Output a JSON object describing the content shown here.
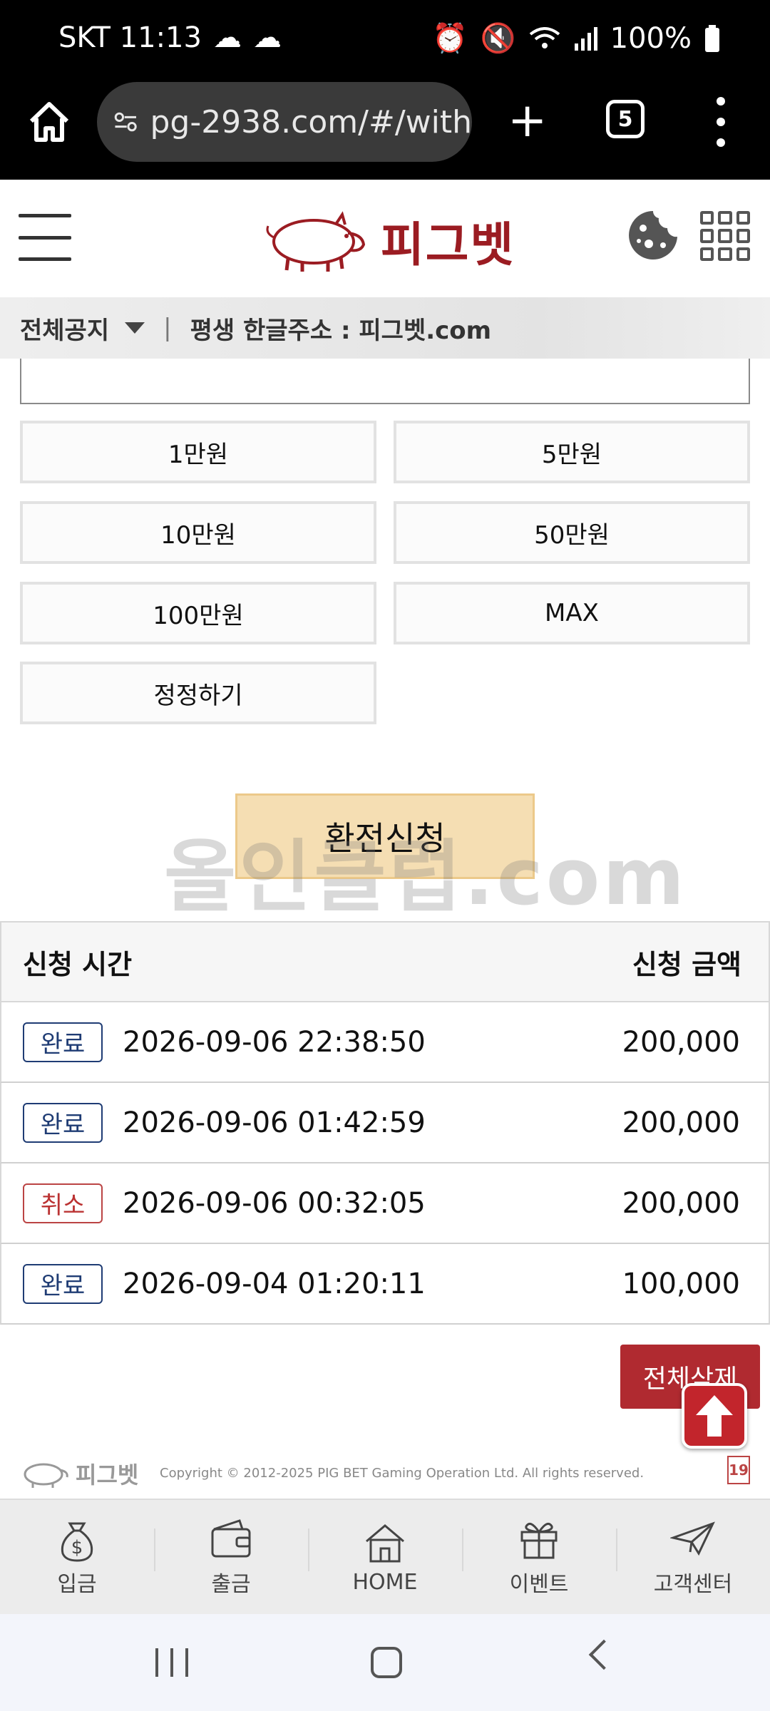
{
  "status_bar": {
    "carrier_time": "SKT 11:13",
    "battery": "100%"
  },
  "browser": {
    "url": "pg-2938.com/#/with",
    "tab_count": "5"
  },
  "header": {
    "logo_text": "피그벳"
  },
  "notice": {
    "category": "전체공지",
    "separator": "|",
    "message": "평생 한글주소 : 피그벳.com"
  },
  "amount_buttons": {
    "b1": "1만원",
    "b2": "5만원",
    "b3": "10만원",
    "b4": "50만원",
    "b5": "100만원",
    "b6": "MAX",
    "reset": "정정하기"
  },
  "submit_label": "환전신청",
  "history": {
    "col_time": "신청 시간",
    "col_amount": "신청 금액",
    "rows": [
      {
        "status": "완료",
        "time": "2026-09-06 22:38:50",
        "amount": "200,000"
      },
      {
        "status": "완료",
        "time": "2026-09-06 01:42:59",
        "amount": "200,000"
      },
      {
        "status": "취소",
        "time": "2026-09-06 00:32:05",
        "amount": "200,000"
      },
      {
        "status": "완료",
        "time": "2026-09-04 01:20:11",
        "amount": "100,000"
      }
    ]
  },
  "delete_all_label": "전체삭제",
  "footer": {
    "logo_text": "피그벳",
    "copyright": "Copyright © 2012-2025 PIG BET Gaming Operation Ltd. All rights reserved.",
    "age_mark": "19"
  },
  "bottom_nav": {
    "deposit": "입금",
    "withdraw": "출금",
    "home": "HOME",
    "event": "이벤트",
    "support": "고객센터"
  },
  "colors": {
    "brand_red": "#b02a30",
    "submit_bg": "#f5deb3",
    "badge_done": "#1f3c74",
    "badge_cancel": "#b33333"
  }
}
